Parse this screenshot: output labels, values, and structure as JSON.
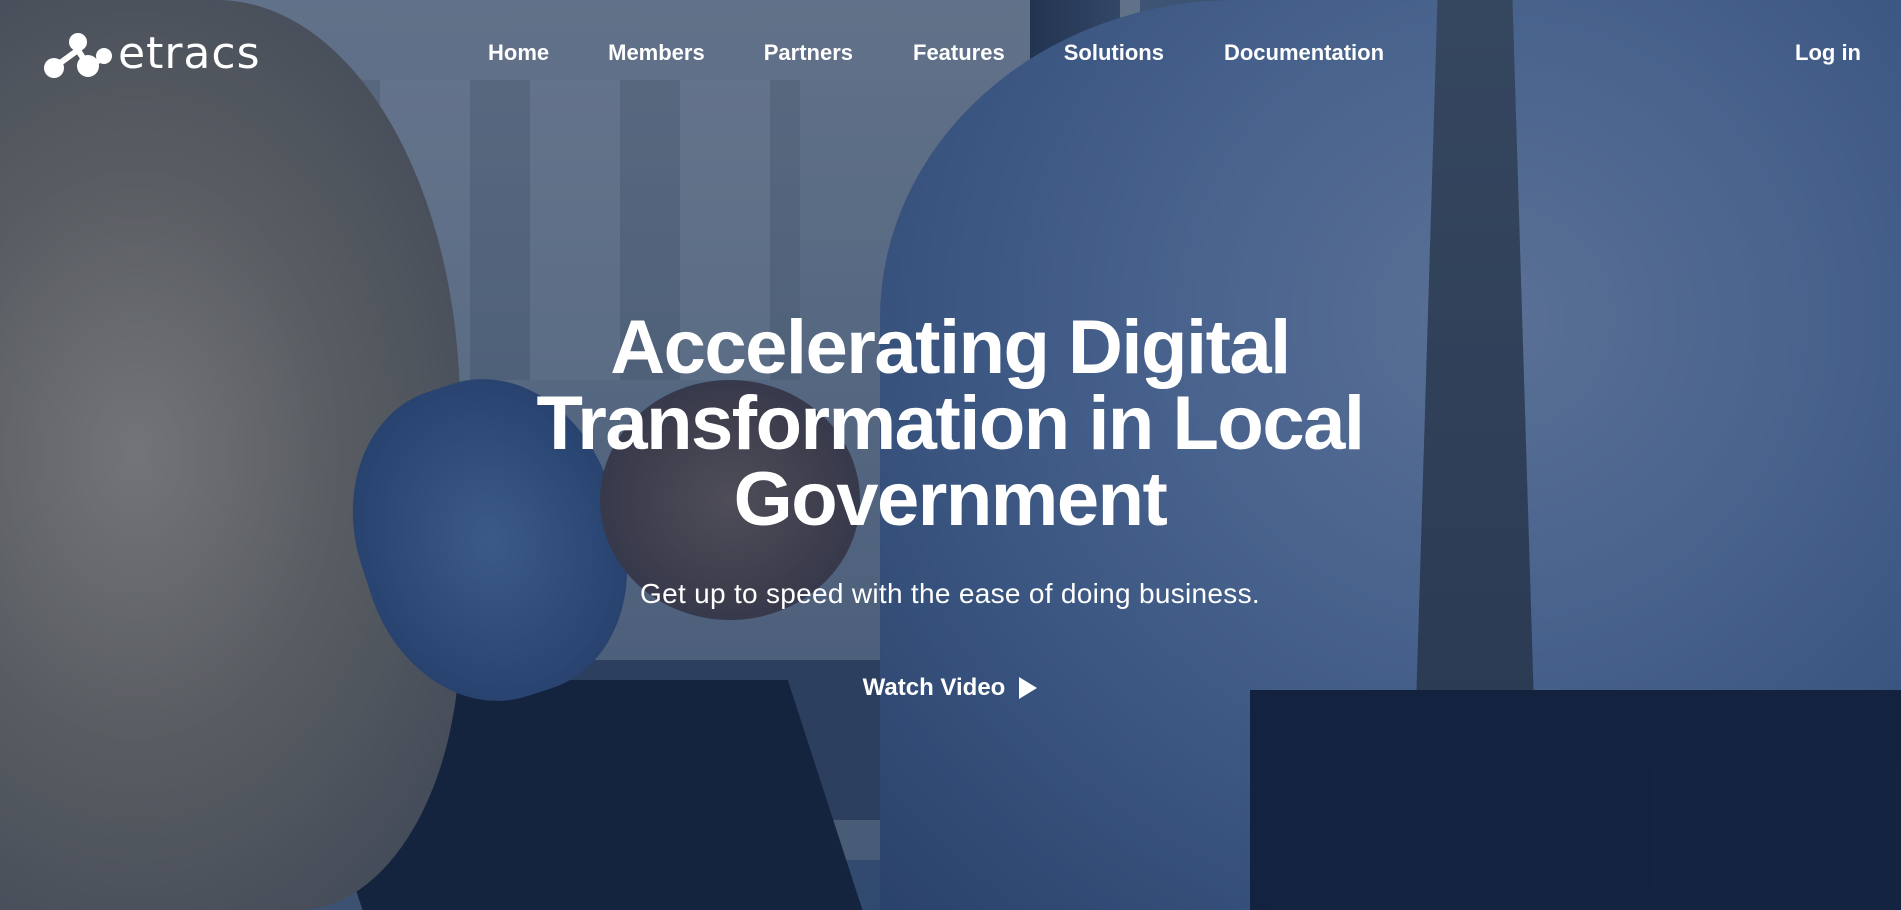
{
  "brand": {
    "name": "etracs",
    "logo_icon": "molecule-dots-icon"
  },
  "nav": {
    "items": [
      {
        "label": "Home"
      },
      {
        "label": "Members"
      },
      {
        "label": "Partners"
      },
      {
        "label": "Features"
      },
      {
        "label": "Solutions"
      },
      {
        "label": "Documentation"
      }
    ],
    "login_label": "Log in"
  },
  "hero": {
    "headline_line1": "Accelerating Digital",
    "headline_line2": "Transformation in Local",
    "headline_line3": "Government",
    "subtitle": "Get up to speed with the ease of doing business.",
    "cta_label": "Watch Video",
    "cta_icon": "play-icon"
  },
  "colors": {
    "text": "#ffffff",
    "overlay": "#142646"
  }
}
